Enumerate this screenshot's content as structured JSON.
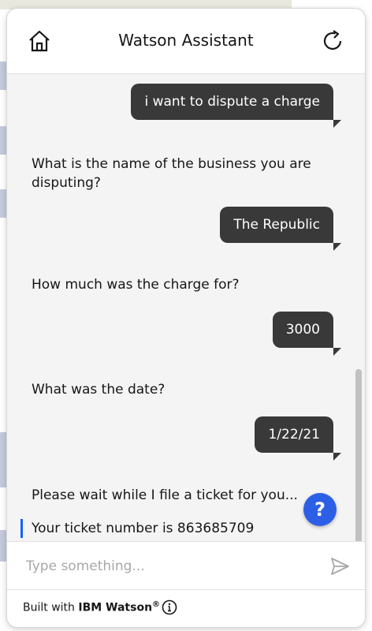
{
  "app": {
    "title": "Watson Assistant"
  },
  "header": {
    "home_icon": "home-icon",
    "restart_icon": "restart-icon"
  },
  "messages": [
    {
      "role": "user",
      "text": "i want to dispute a charge"
    },
    {
      "role": "bot",
      "text": "What is the name of the business you are disputing?"
    },
    {
      "role": "user",
      "text": "The Republic"
    },
    {
      "role": "bot",
      "text": "How much was the charge for?"
    },
    {
      "role": "user",
      "text": "3000"
    },
    {
      "role": "bot",
      "text": "What was the date?"
    },
    {
      "role": "user",
      "text": "1/22/21"
    },
    {
      "role": "bot",
      "text": "Please wait while I file a ticket for you..."
    },
    {
      "role": "bot",
      "text": "Your ticket number is 863685709"
    }
  ],
  "help_button": {
    "label": "?"
  },
  "input": {
    "placeholder": "Type something...",
    "value": "",
    "send_icon": "send-icon"
  },
  "footer": {
    "prefix": "Built with ",
    "brand": "IBM Watson",
    "trademark": "®",
    "info_icon": "info-icon"
  },
  "colors": {
    "user_bubble": "#393939",
    "accent": "#0f62fe",
    "help_button": "#2d5fe6"
  }
}
